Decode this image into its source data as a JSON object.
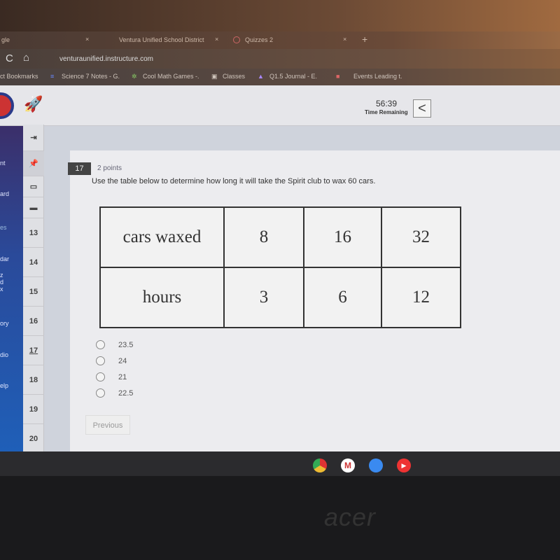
{
  "browser": {
    "tabs": [
      {
        "label": "gle"
      },
      {
        "label": "Ventura Unified School District"
      },
      {
        "label": "Quizzes 2"
      }
    ],
    "new_tab": "+",
    "close": "×",
    "url": "venturaunified.instructure.com",
    "bookmarks": [
      "ct Bookmarks",
      "Science 7 Notes - G.",
      "Cool Math Games -.",
      "Classes",
      "Q1.5 Journal - E.",
      "Events Leading t."
    ]
  },
  "header": {
    "timer": "56:39",
    "timer_label": "Time Remaining",
    "back": "<"
  },
  "left_nav": [
    "nt",
    "ard",
    "es",
    "dar",
    "z d x",
    "ory",
    "dio",
    "elp"
  ],
  "question_nav": {
    "items": [
      "13",
      "14",
      "15",
      "16",
      "17",
      "18",
      "19",
      "20"
    ],
    "current": "17"
  },
  "question": {
    "number": "17",
    "points": "2 points",
    "text": "Use the table below to determine how long it will take the Spirit club to wax 60 cars.",
    "table": [
      [
        "cars waxed",
        "8",
        "16",
        "32"
      ],
      [
        "hours",
        "3",
        "6",
        "12"
      ]
    ],
    "options": [
      "23.5",
      "24",
      "21",
      "22.5"
    ],
    "previous": "Previous"
  },
  "device": {
    "brand": "acer"
  },
  "colors": {
    "nav": "#2a4a9a",
    "badge": "#444444"
  }
}
